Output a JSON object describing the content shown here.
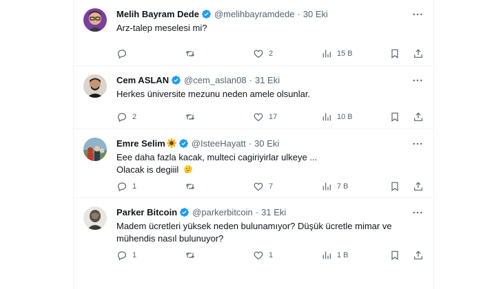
{
  "tweets": [
    {
      "name": "Melih Bayram Dede",
      "handle": "@melihbayramdede",
      "dot": "·",
      "date": "30 Eki",
      "text_lines": [
        "Arz-talep meselesi mi?"
      ],
      "replies": "",
      "retweets": "",
      "likes": "2",
      "views": "15 B"
    },
    {
      "name": "Cem ASLAN",
      "handle": "@cem_aslan08",
      "dot": "·",
      "date": "31 Eki",
      "text_lines": [
        "Herkes üniversite mezunu neden amele olsunlar."
      ],
      "replies": "2",
      "retweets": "",
      "likes": "17",
      "views": "10 B"
    },
    {
      "name": "Emre Selim",
      "handle": "@IsteeHayatt",
      "dot": "·",
      "date": "30 Eki",
      "text_lines": [
        "Eee daha fazla kacak, multeci cagiriyirlar ulkeye ...",
        "Olacak is degiiil"
      ],
      "replies": "1",
      "retweets": "",
      "likes": "7",
      "views": "7 B"
    },
    {
      "name": "Parker Bitcoin",
      "handle": "@parkerbitcoin",
      "dot": "·",
      "date": "31 Eki",
      "text_lines": [
        "Madem ücretleri yüksek neden bulunamıyor? Düşük ücretle mimar ve",
        "mühendis nasıl bulunuyor?"
      ],
      "replies": "1",
      "retweets": "",
      "likes": "1",
      "views": "1 B"
    }
  ],
  "colors": {
    "verified": "#1d9bf0",
    "muted": "#536471",
    "text": "#0f1419",
    "border": "#eff3f4"
  },
  "icons": [
    "reply-icon",
    "retweet-icon",
    "like-icon",
    "views-icon",
    "bookmark-icon",
    "share-icon",
    "more-icon",
    "verified-badge-icon",
    "sunflower-emoji",
    "thinking-emoji"
  ]
}
